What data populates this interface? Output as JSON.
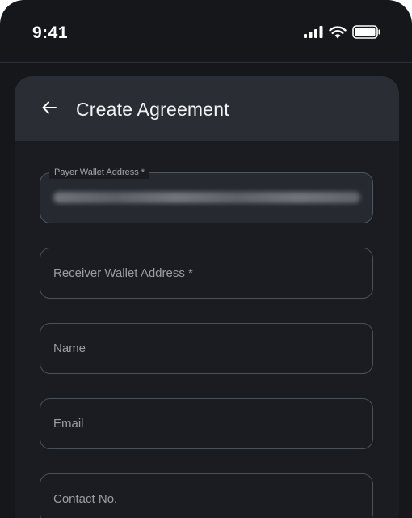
{
  "status_bar": {
    "time": "9:41",
    "icons": [
      "cellular-signal-icon",
      "wifi-icon",
      "battery-icon"
    ]
  },
  "header": {
    "back_icon": "arrow-left-icon",
    "title": "Create Agreement"
  },
  "form": {
    "payer_wallet": {
      "label": "Payer Wallet Address *",
      "value_obscured": true
    },
    "receiver_wallet": {
      "placeholder": "Receiver Wallet Address *"
    },
    "name": {
      "placeholder": "Name"
    },
    "email": {
      "placeholder": "Email"
    },
    "contact": {
      "placeholder": "Contact No."
    }
  },
  "colors": {
    "background": "#15171b",
    "card": "#1a1c21",
    "header": "#2a2d34",
    "border": "#4b4f57",
    "placeholder": "#9a9da3",
    "text": "#ffffff"
  }
}
